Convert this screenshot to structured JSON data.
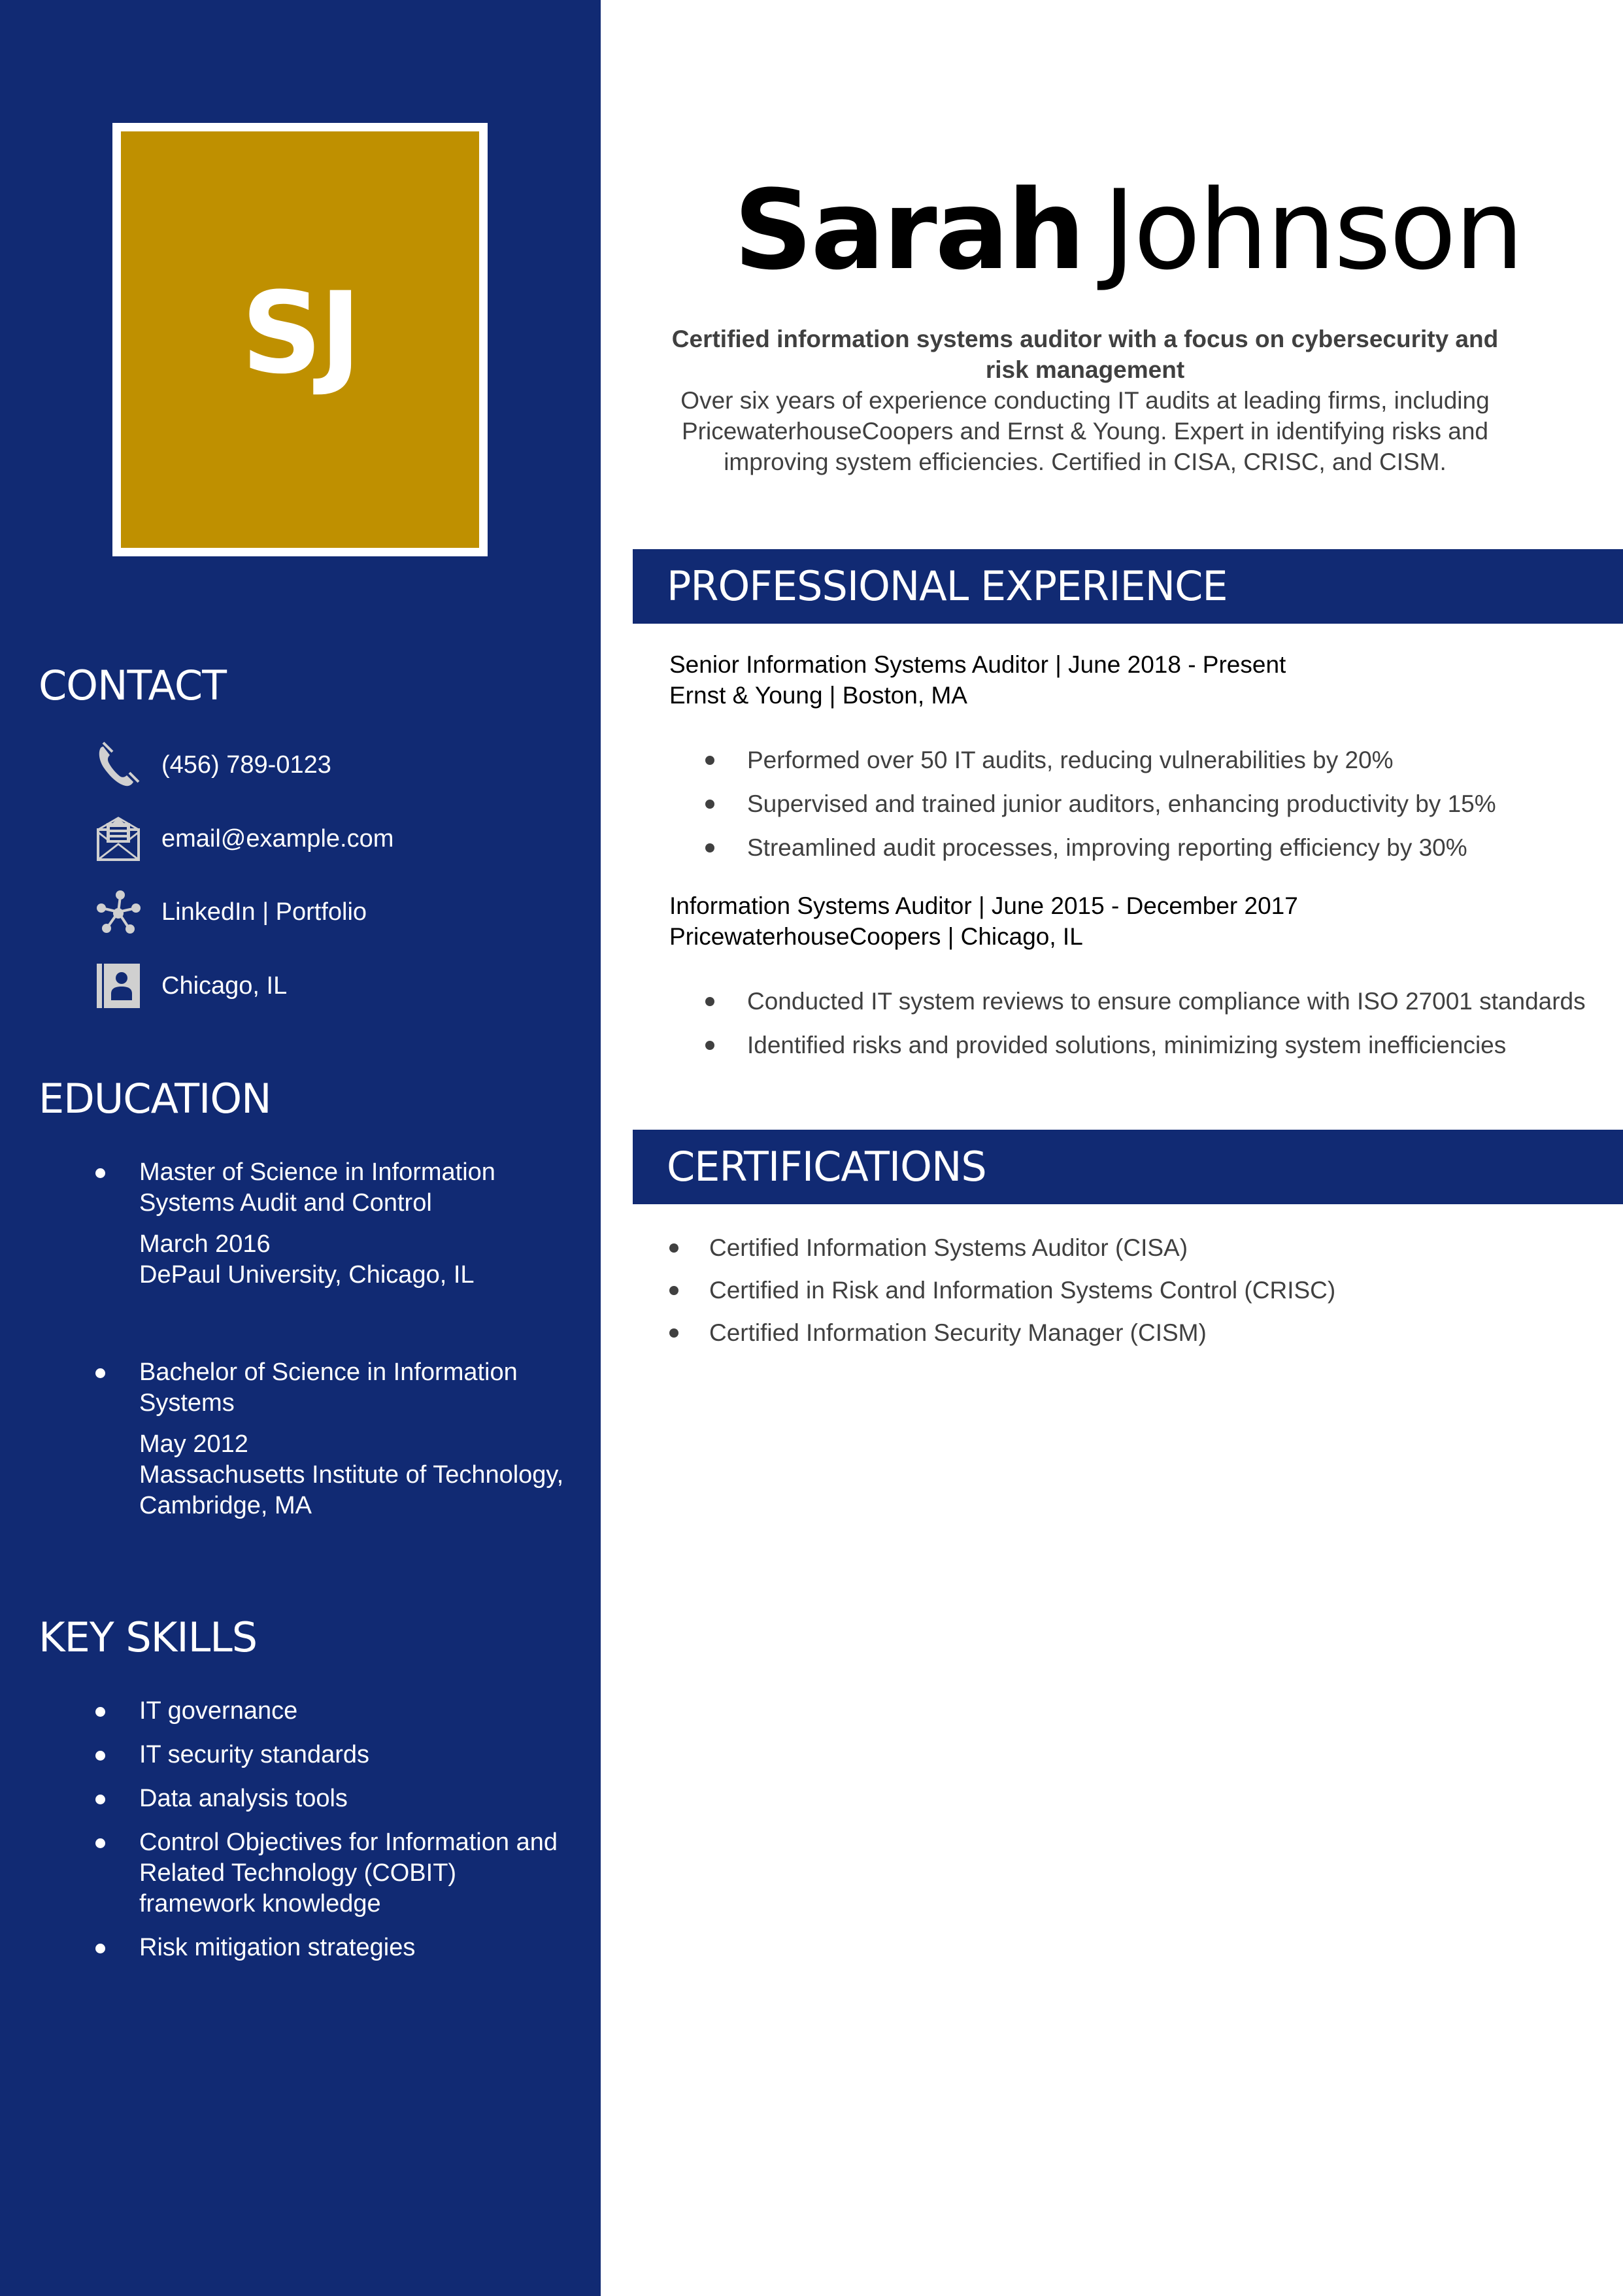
{
  "colors": {
    "sidebar_bg": "#112a73",
    "avatar_bg": "#bf9000",
    "icon_color": "#d0d0d0",
    "body_text": "#404040"
  },
  "avatar": {
    "initials": "SJ"
  },
  "header": {
    "first_name": "Sarah",
    "last_name": "Johnson"
  },
  "summary": {
    "headline": "Certified information systems auditor with a focus on cybersecurity and risk management",
    "body": "Over six years of experience conducting IT audits at leading firms, including PricewaterhouseCoopers and Ernst & Young. Expert in identifying risks and improving system efficiencies. Certified in CISA, CRISC, and CISM."
  },
  "contact": {
    "heading": "CONTACT",
    "items": [
      {
        "icon": "phone-icon",
        "text": "(456) 789-0123"
      },
      {
        "icon": "email-icon",
        "text": "email@example.com"
      },
      {
        "icon": "network-icon",
        "text": "LinkedIn | Portfolio"
      },
      {
        "icon": "contact-card-icon",
        "text": "Chicago, IL"
      }
    ]
  },
  "education": {
    "heading": "EDUCATION",
    "items": [
      {
        "degree": "Master of Science in Information Systems Audit and Control",
        "date": "March 2016",
        "school": "DePaul University, Chicago, IL"
      },
      {
        "degree": "Bachelor of Science in Information Systems",
        "date": "May 2012",
        "school": "Massachusetts Institute of Technology, Cambridge, MA"
      }
    ]
  },
  "skills": {
    "heading": "KEY SKILLS",
    "items": [
      "IT governance",
      "IT security standards",
      "Data analysis tools",
      "Control Objectives for Information and Related Technology (COBIT) framework knowledge",
      "Risk mitigation strategies"
    ]
  },
  "experience": {
    "heading": "PROFESSIONAL EXPERIENCE",
    "jobs": [
      {
        "title_line": "Senior Information Systems Auditor | June 2018 - Present",
        "company_line": "Ernst & Young | Boston, MA",
        "bullets": [
          "Performed over 50 IT audits, reducing vulnerabilities by 20%",
          "Supervised and trained junior auditors, enhancing productivity by 15%",
          "Streamlined audit processes, improving reporting efficiency by 30%"
        ]
      },
      {
        "title_line": "Information Systems Auditor | June 2015 - December 2017",
        "company_line": "PricewaterhouseCoopers | Chicago, IL",
        "bullets": [
          "Conducted IT system reviews to ensure compliance with ISO 27001 standards",
          "Identified risks and provided solutions, minimizing system inefficiencies"
        ]
      }
    ]
  },
  "certifications": {
    "heading": "CERTIFICATIONS",
    "items": [
      "Certified Information Systems Auditor (CISA)",
      "Certified in Risk and Information Systems Control (CRISC)",
      "Certified Information Security Manager (CISM)"
    ]
  }
}
